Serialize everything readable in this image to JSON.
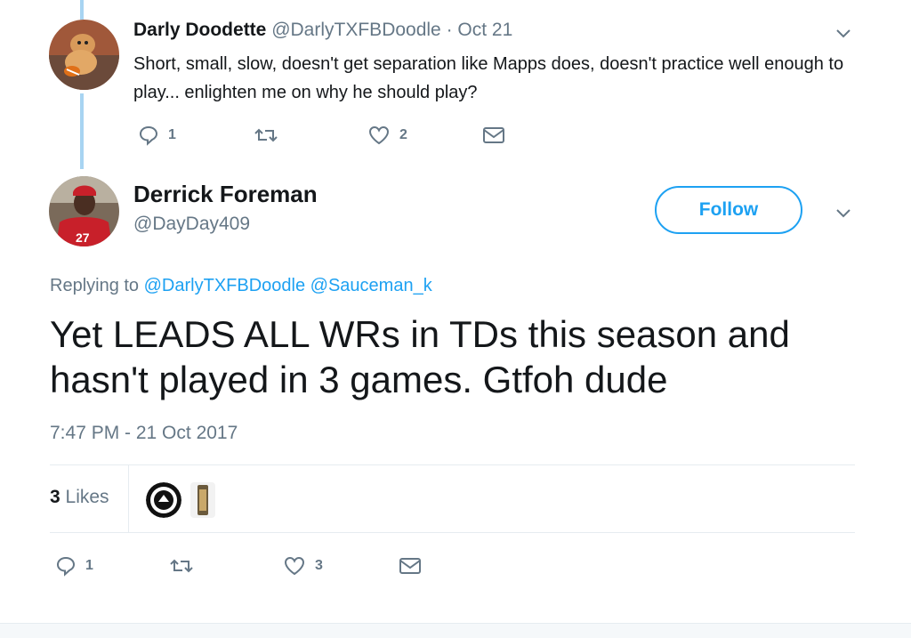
{
  "parent_tweet": {
    "name": "Darly Doodette",
    "handle": "@DarlyTXFBDoodle",
    "date": "· Oct 21",
    "text": "Short, small, slow, doesn't get separation like Mapps does, doesn't practice well enough to play... enlighten me on why he should play?",
    "reply_count": "1",
    "retweet_count": "",
    "like_count": "2"
  },
  "main_tweet": {
    "name": "Derrick Foreman",
    "handle": "@DayDay409",
    "follow_label": "Follow",
    "replying_prefix": "Replying to",
    "replying_to_1": "@DarlyTXFBDoodle",
    "replying_to_2": "@Sauceman_k",
    "text": "Yet LEADS ALL WRs in TDs this season and hasn't played in 3 games. Gtfoh dude",
    "timestamp": "7:47 PM - 21 Oct 2017",
    "likes_count": "3",
    "likes_label": "Likes",
    "reply_count": "1",
    "like_count": "3"
  },
  "liker_avatars": [
    "BLOCK NATION",
    ""
  ],
  "colors": {
    "accent": "#1da1f2",
    "muted": "#657786",
    "thread_line": "#a8d4f2",
    "divider": "#e6ecf0"
  },
  "icons": [
    "chevron-down-icon",
    "reply-icon",
    "retweet-icon",
    "heart-icon",
    "envelope-icon"
  ]
}
